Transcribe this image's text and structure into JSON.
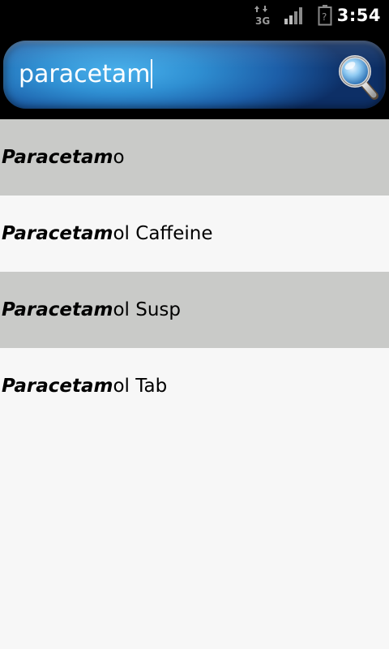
{
  "status_bar": {
    "time": "3:54",
    "network_label": "3G",
    "network_icon": "network-3g-icon",
    "signal_icon": "signal-strength-icon",
    "battery_icon": "battery-unknown-icon"
  },
  "search": {
    "query": "paracetam",
    "button_icon": "magnifier-icon",
    "accent_color": "#2f8fd2"
  },
  "results": [
    {
      "match": "Paracetam",
      "rest": "o"
    },
    {
      "match": "Paracetam",
      "rest": "ol Caffeine"
    },
    {
      "match": "Paracetam",
      "rest": "ol Susp"
    },
    {
      "match": "Paracetam",
      "rest": "ol Tab"
    }
  ],
  "colors": {
    "row_shaded": "#c9cac8",
    "row_plain": "#f7f7f7"
  }
}
